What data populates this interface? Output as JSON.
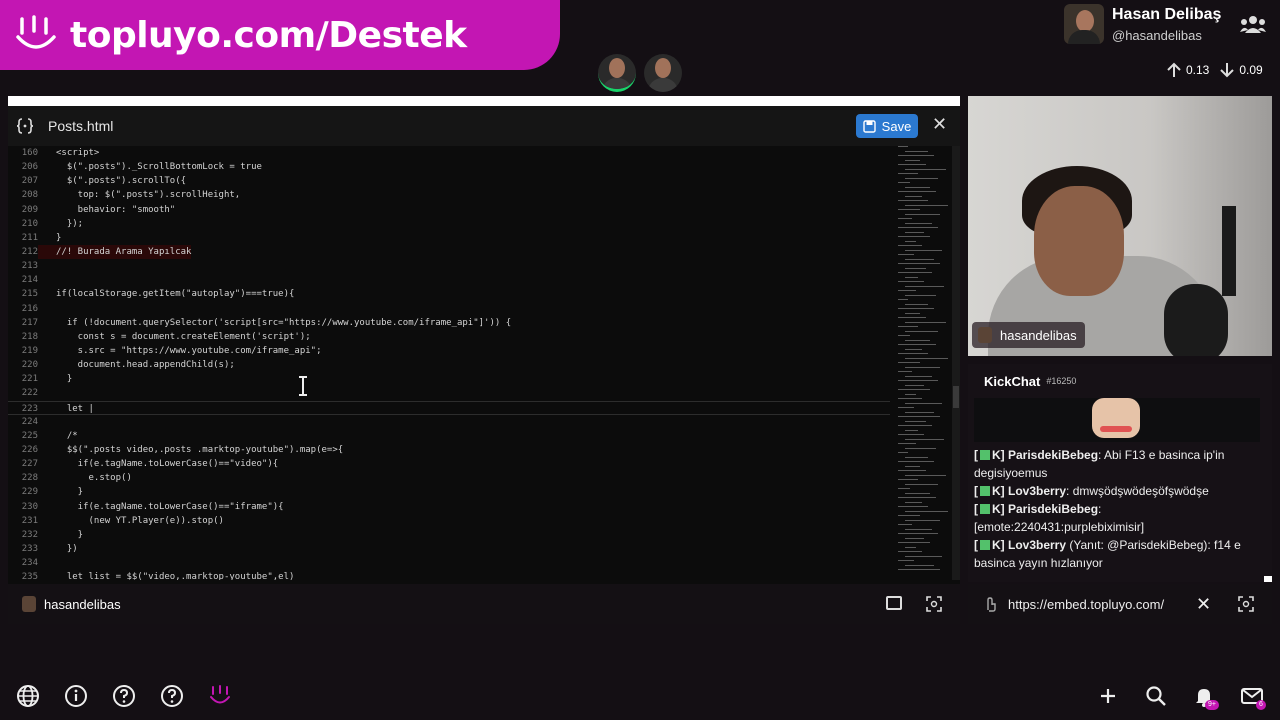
{
  "brand": {
    "title": "topluyo.com/Destek"
  },
  "user": {
    "name": "Hasan Delibaş",
    "handle": "@hasandelibas"
  },
  "network": {
    "up": "0.13",
    "down": "0.09"
  },
  "editor": {
    "filename": "Posts.html",
    "save_label": "Save",
    "footer_user": "hasandelibas",
    "lines": [
      {
        "n": "160",
        "t": "<script>",
        "cls": "c-kw"
      },
      {
        "n": "206",
        "t": "  $(\".posts\")._ScrollBottomLock = true",
        "cls": ""
      },
      {
        "n": "207",
        "t": "  $(\".posts\").scrollTo({",
        "cls": ""
      },
      {
        "n": "208",
        "t": "    top: $(\".posts\").scrollHeight,",
        "cls": ""
      },
      {
        "n": "209",
        "t": "    behavior: \"smooth\"",
        "cls": ""
      },
      {
        "n": "210",
        "t": "  });",
        "cls": ""
      },
      {
        "n": "211",
        "t": "}",
        "cls": ""
      },
      {
        "n": "212",
        "t": "//! Burada Arama Yapılcak",
        "cls": "c-red"
      },
      {
        "n": "213",
        "t": "",
        "cls": ""
      },
      {
        "n": "214",
        "t": "",
        "cls": ""
      },
      {
        "n": "215",
        "t": "if(localStorage.getItem(\"autoplay\")===true){",
        "cls": ""
      },
      {
        "n": "216",
        "t": "",
        "cls": ""
      },
      {
        "n": "217",
        "t": "  if (!document.querySelector('script[src=\"https://www.youtube.com/iframe_api\"]')) {",
        "cls": ""
      },
      {
        "n": "218",
        "t": "    const s = document.createElement('script');",
        "cls": ""
      },
      {
        "n": "219",
        "t": "    s.src = \"https://www.youtube.com/iframe_api\";",
        "cls": ""
      },
      {
        "n": "220",
        "t": "    document.head.appendChild(s);",
        "cls": ""
      },
      {
        "n": "221",
        "t": "  }",
        "cls": ""
      },
      {
        "n": "222",
        "t": "",
        "cls": ""
      },
      {
        "n": "223",
        "t": "  let |",
        "cls": "hl"
      },
      {
        "n": "224",
        "t": "",
        "cls": ""
      },
      {
        "n": "225",
        "t": "  /*",
        "cls": "c-cmt"
      },
      {
        "n": "226",
        "t": "  $$(\".posts video,.posts .marktop-youtube\").map(e=>{",
        "cls": ""
      },
      {
        "n": "227",
        "t": "    if(e.tagName.toLowerCase()==\"video\"){",
        "cls": ""
      },
      {
        "n": "228",
        "t": "      e.stop()",
        "cls": ""
      },
      {
        "n": "229",
        "t": "    }",
        "cls": ""
      },
      {
        "n": "230",
        "t": "    if(e.tagName.toLowerCase()==\"iframe\"){",
        "cls": ""
      },
      {
        "n": "231",
        "t": "      (new YT.Player(e)).stop()",
        "cls": ""
      },
      {
        "n": "232",
        "t": "    }",
        "cls": ""
      },
      {
        "n": "233",
        "t": "  })",
        "cls": ""
      },
      {
        "n": "234",
        "t": "",
        "cls": ""
      },
      {
        "n": "235",
        "t": "  let list = $$(\"video,.marktop-youtube\",el)",
        "cls": ""
      }
    ]
  },
  "video": {
    "name_tag": "hasandelibas"
  },
  "chat": {
    "title": "KickChat",
    "channel": "#16250",
    "messages": [
      {
        "prefix": "[",
        "tag": "K]",
        "user": "ParisdekiBebeg",
        "reply": "",
        "text": ": Abi F13 e basinca ip'in degisiyoemus"
      },
      {
        "prefix": "[",
        "tag": "K]",
        "user": "Lov3berry",
        "reply": "",
        "text": ": dmwşödşwödeşöfşwödşe"
      },
      {
        "prefix": "[",
        "tag": "K]",
        "user": "ParisdekiBebeg",
        "reply": "",
        "text": ": [emote:2240431:purplebiximisir]"
      },
      {
        "prefix": "[",
        "tag": "K]",
        "user": "Lov3berry",
        "reply": "(Yanıt: @ParisdekiBebeg)",
        "text": ": f14 e basinca yayın hızlanıyor"
      }
    ],
    "url": "https://embed.topluyo.com/"
  },
  "notifications": {
    "count": "9+"
  },
  "messages_badge": {
    "count": "6"
  }
}
